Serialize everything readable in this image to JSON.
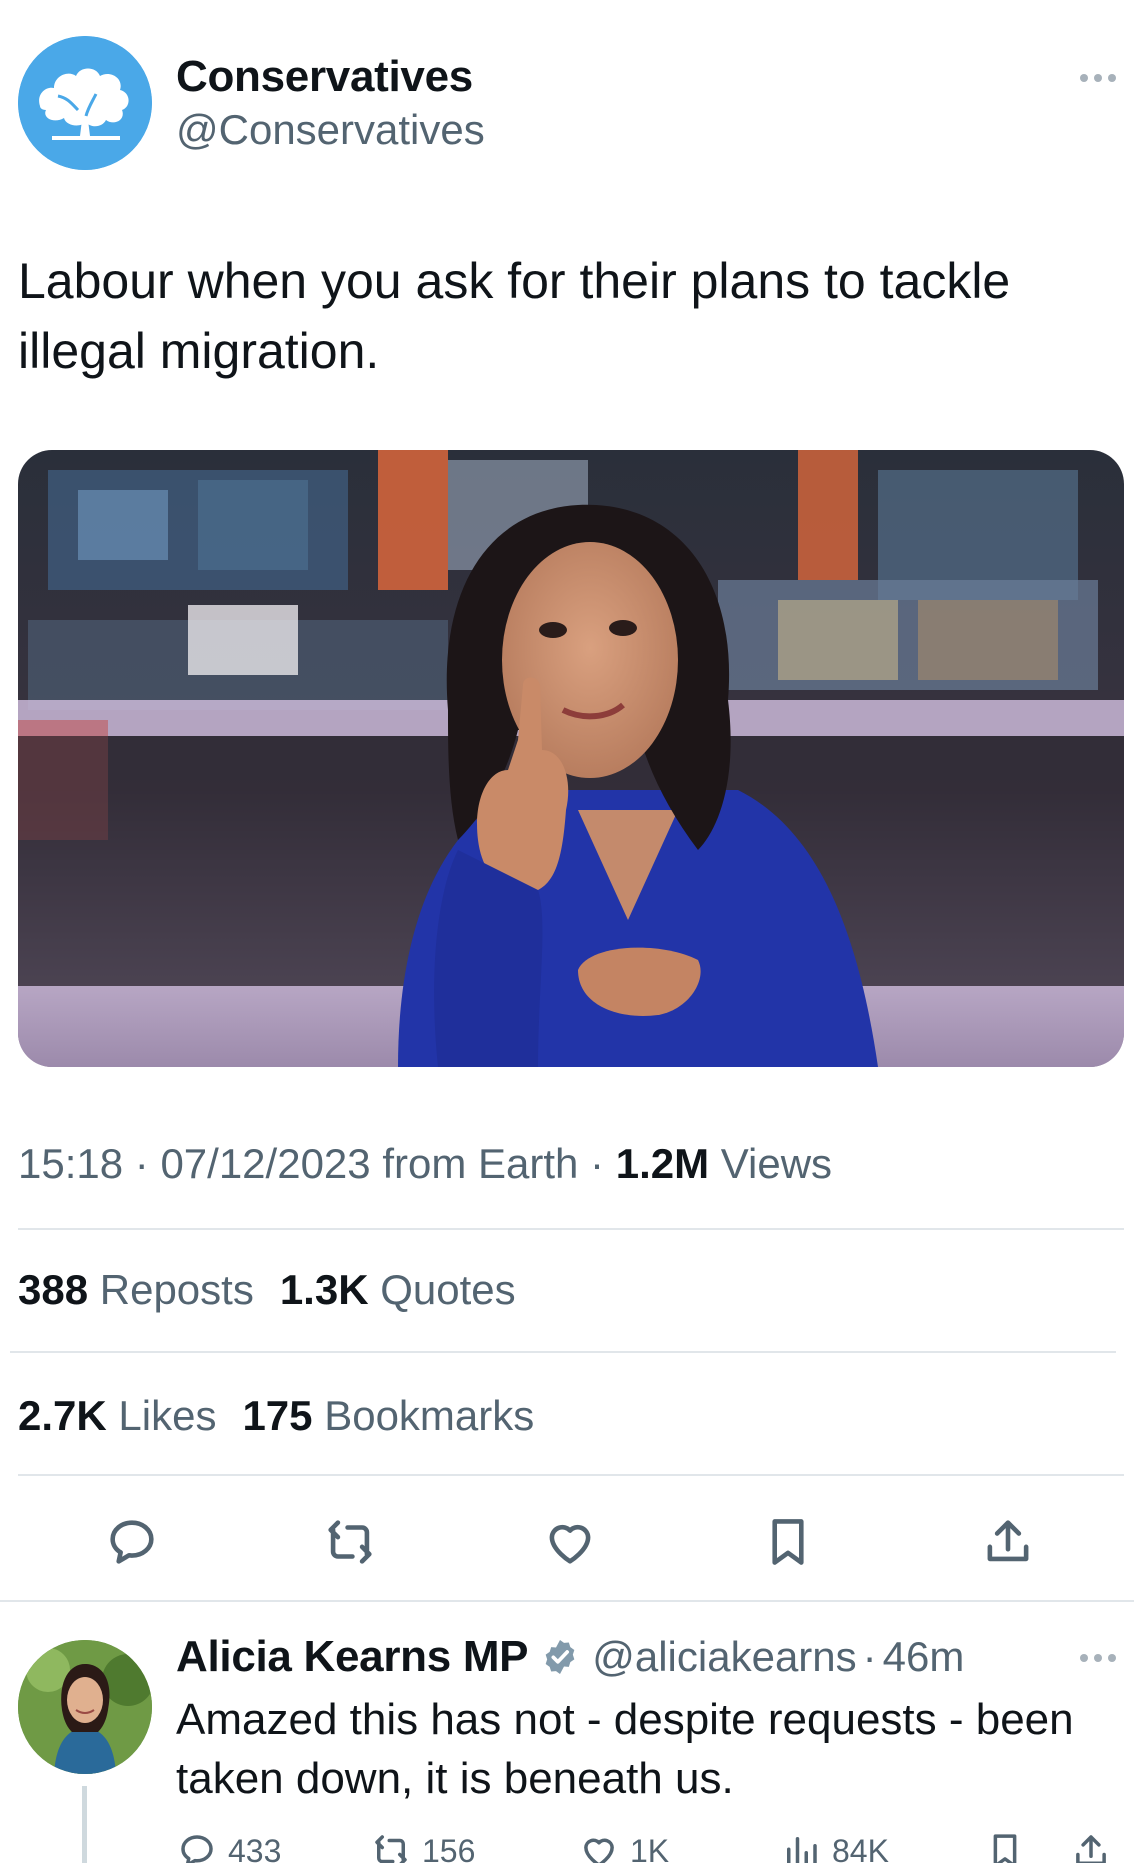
{
  "tweet": {
    "author": {
      "name": "Conservatives",
      "handle": "@Conservatives",
      "avatar_icon": "oak-tree-logo-icon",
      "avatar_color": "#4aa8e8"
    },
    "text": "Labour when you ask for their plans to tackle illegal migration.",
    "media": {
      "icon": "news-presenter-photo"
    },
    "meta": {
      "time": "15:18",
      "sep1": " · ",
      "date": "07/12/2023",
      "from": " from Earth",
      "sep2": " · ",
      "views_count": "1.2M",
      "views_label": " Views"
    },
    "stats": {
      "reposts_count": "388",
      "reposts_label": "Reposts",
      "quotes_count": "1.3K",
      "quotes_label": "Quotes",
      "likes_count": "2.7K",
      "likes_label": "Likes",
      "bookmarks_count": "175",
      "bookmarks_label": "Bookmarks"
    },
    "actions": [
      "reply-icon",
      "repost-icon",
      "like-icon",
      "bookmark-icon",
      "share-icon"
    ]
  },
  "reply": {
    "name": "Alicia Kearns MP",
    "verified_icon": "verified-badge-icon",
    "handle": "@aliciakearns",
    "sep": "·",
    "time": "46m",
    "text": "Amazed this has not - despite requests - been taken down, it is beneath us.",
    "counts": {
      "replies": "433",
      "reposts": "156",
      "likes": "1K",
      "views": "84K"
    }
  },
  "colors": {
    "secondary_text": "#536471",
    "primary_text": "#0f1419",
    "divider": "#e1e6ea",
    "icon": "#536471"
  }
}
